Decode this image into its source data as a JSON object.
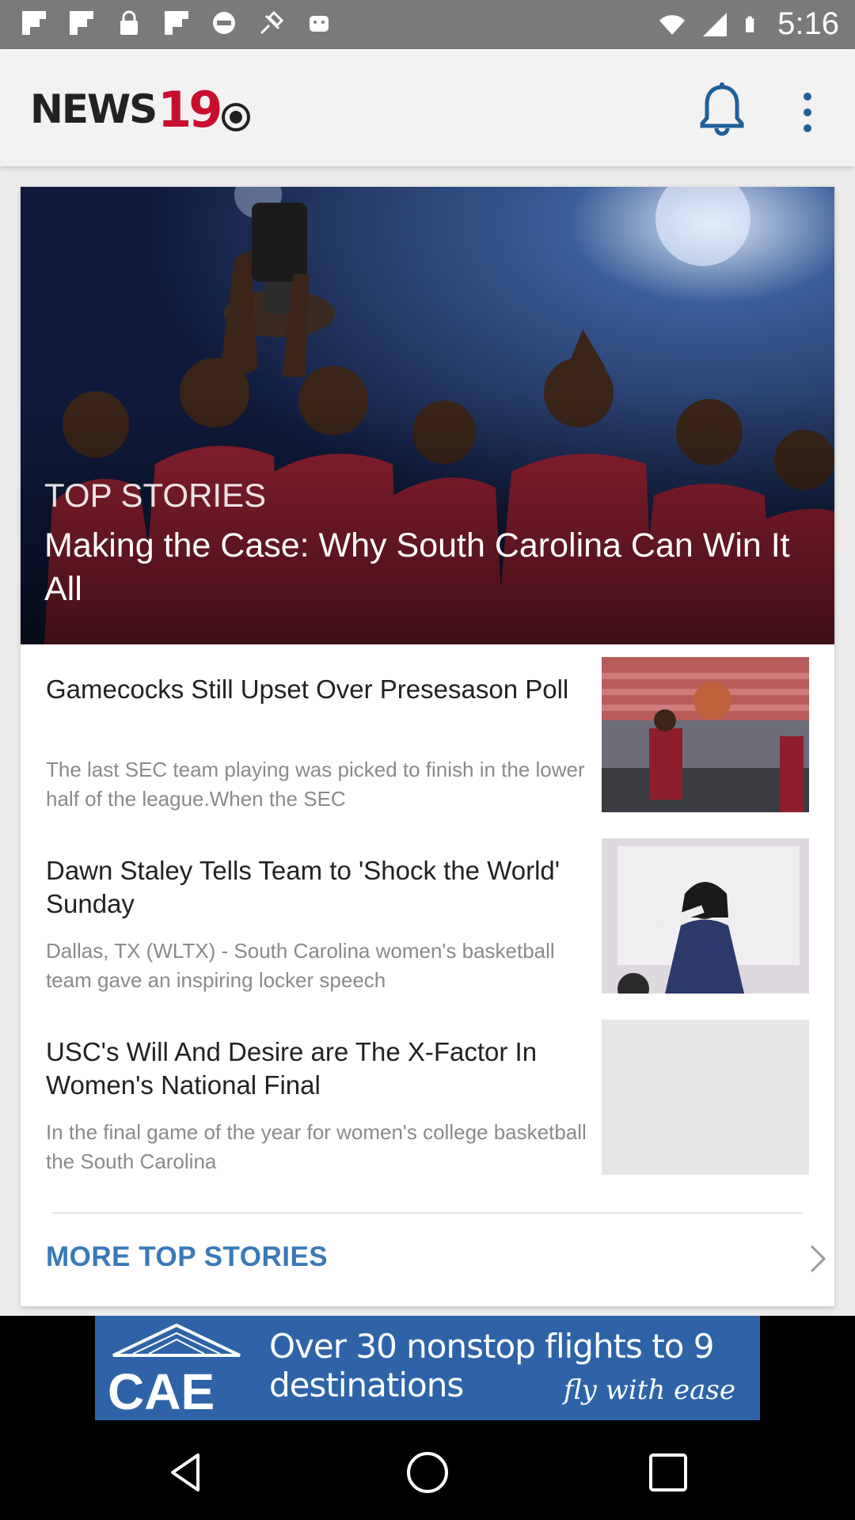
{
  "status_bar": {
    "time": "5:16",
    "left_icons": [
      "flipboard-icon",
      "flipboard-icon",
      "lock-icon",
      "flipboard-icon",
      "blocked-icon",
      "fake-gps-icon",
      "android-icon"
    ],
    "right_icons": [
      "wifi-icon",
      "signal-icon",
      "battery-icon"
    ]
  },
  "header": {
    "logo_text": "NEWS",
    "logo_number": "19",
    "icons": [
      "bell-icon",
      "more-vertical-icon"
    ],
    "accent_color": "#c8102e"
  },
  "hero": {
    "kicker": "TOP STORIES",
    "title": "Making the Case: Why South Carolina Can Win It All"
  },
  "stories": [
    {
      "title": "Gamecocks Still Upset Over Presesason Poll",
      "description": "The last SEC team playing was picked to finish in the lower half of the league.When the SEC"
    },
    {
      "title": "Dawn Staley Tells Team to 'Shock the World' Sunday",
      "description": "Dallas, TX (WLTX) - South Carolina women's basketball team gave an inspiring locker speech"
    },
    {
      "title": "USC's Will And Desire are The X-Factor In Women's National Final",
      "description": "In the final game of the year for women's college basketball the South Carolina"
    }
  ],
  "more": {
    "label": "MORE TOP STORIES",
    "color": "#3a78b8"
  },
  "ad": {
    "logo": "CAE",
    "headline": "Over 30 nonstop flights to 9 destinations",
    "tagline": "fly with ease"
  },
  "nav": {
    "icons": [
      "back-icon",
      "home-icon",
      "recents-icon"
    ]
  }
}
